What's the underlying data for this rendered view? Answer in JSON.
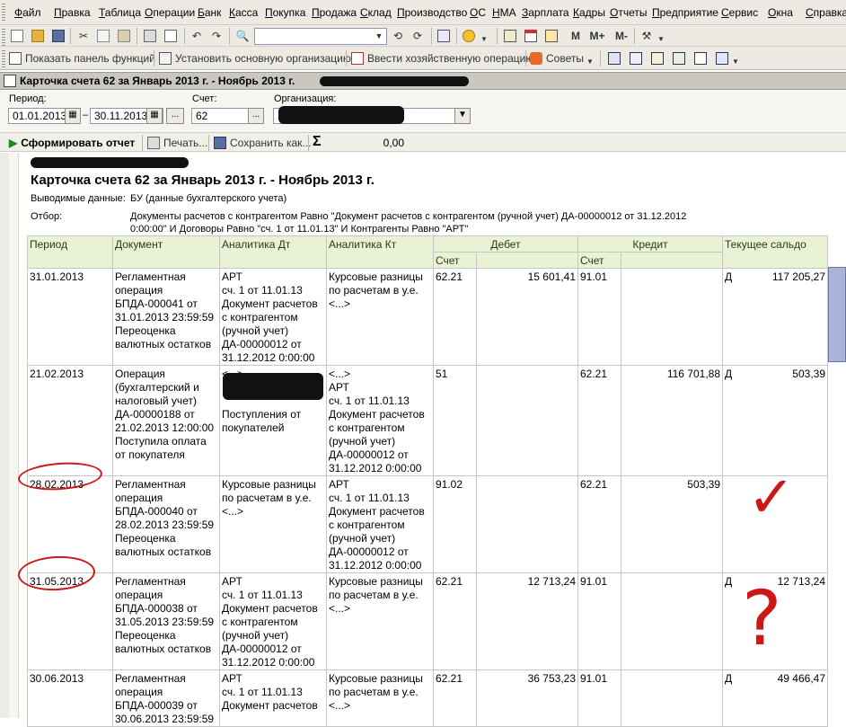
{
  "menu": [
    "Файл",
    "Правка",
    "Таблица",
    "Операции",
    "Банк",
    "Касса",
    "Покупка",
    "Продажа",
    "Склад",
    "Производство",
    "ОС",
    "НМА",
    "Зарплата",
    "Кадры",
    "Отчеты",
    "Предприятие",
    "Сервис",
    "Окна",
    "Справка"
  ],
  "toolbar2": {
    "show_panel": "Показать панель функций",
    "set_org": "Установить основную организацию",
    "enter_op": "Ввести хозяйственную операцию",
    "tips": "Советы"
  },
  "toolbar1": {
    "m1": "M",
    "m2": "M+",
    "m3": "M-"
  },
  "window": {
    "title": "Карточка счета 62 за Январь 2013 г. - Ноябрь 2013 г."
  },
  "form": {
    "period_label": "Период:",
    "date_from": "01.01.2013",
    "date_to": "30.11.2013",
    "account_label": "Счет:",
    "account": "62",
    "org_label": "Организация:",
    "ellipsis": "...",
    "dash": "–"
  },
  "actions": {
    "generate": "Сформировать отчет",
    "print": "Печать...",
    "save": "Сохранить как...",
    "sum_symbol": "Σ",
    "sum": "0,00"
  },
  "report": {
    "title": "Карточка счета 62 за Январь 2013 г. - Ноябрь 2013 г.",
    "output_label": "Выводимые данные:",
    "output_value": "БУ (данные бухгалтерского учета)",
    "filter_label": "Отбор:",
    "filter_line1": "Документы расчетов с контрагентом Равно \"Документ расчетов с контрагентом (ручной учет) ДА-00000012 от 31.12.2012",
    "filter_line2": "0:00:00\" И Договоры Равно \"сч. 1 от 11.01.13\" И Контрагенты Равно \"АРТ\"",
    "headers": {
      "period": "Период",
      "document": "Документ",
      "an_dt": "Аналитика Дт",
      "an_kt": "Аналитика Кт",
      "debit": "Дебет",
      "credit": "Кредит",
      "balance": "Текущее сальдо",
      "account": "Счет"
    },
    "rows": [
      {
        "period": "31.01.2013",
        "doc": [
          "Регламентная",
          "операция",
          "БПДА-000041 от",
          "31.01.2013 23:59:59",
          "Переоценка",
          "валютных остатков"
        ],
        "dt": [
          "АРТ",
          "сч. 1 от 11.01.13",
          "Документ расчетов",
          "с контрагентом",
          "(ручной учет)",
          "ДА-00000012 от",
          "31.12.2012 0:00:00"
        ],
        "kt": [
          "Курсовые разницы",
          "по расчетам в у.е.",
          "<...>"
        ],
        "d_acc": "62.21",
        "d_sum": "15 601,41",
        "c_acc": "91.01",
        "c_sum": "",
        "b_side": "Д",
        "b_sum": "117 205,27"
      },
      {
        "period": "21.02.2013",
        "doc": [
          "Операция",
          "(бухгалтерский и",
          "налоговый учет)",
          "ДА-00000188 от",
          "21.02.2013 12:00:00",
          "Поступила оплата",
          "от покупателя"
        ],
        "dt": [
          "<...>",
          "",
          "",
          "Поступления от",
          "покупателей"
        ],
        "kt": [
          "<...>",
          "АРТ",
          "сч. 1 от 11.01.13",
          "Документ расчетов",
          "с контрагентом",
          "(ручной учет)",
          "ДА-00000012 от",
          "31.12.2012 0:00:00"
        ],
        "d_acc": "51",
        "d_sum": "",
        "c_acc": "62.21",
        "c_sum": "116 701,88",
        "b_side": "Д",
        "b_sum": "503,39"
      },
      {
        "period": "28.02.2013",
        "doc": [
          "Регламентная",
          "операция",
          "БПДА-000040 от",
          "28.02.2013 23:59:59",
          "Переоценка",
          "валютных остатков"
        ],
        "dt": [
          "Курсовые разницы",
          "по расчетам в у.е.",
          "<...>"
        ],
        "kt": [
          "АРТ",
          "сч. 1 от 11.01.13",
          "Документ расчетов",
          "с контрагентом",
          "(ручной учет)",
          "ДА-00000012 от",
          "31.12.2012 0:00:00"
        ],
        "d_acc": "91.02",
        "d_sum": "",
        "c_acc": "62.21",
        "c_sum": "503,39",
        "b_side": "",
        "b_sum": ""
      },
      {
        "period": "31.05.2013",
        "doc": [
          "Регламентная",
          "операция",
          "БПДА-000038 от",
          "31.05.2013 23:59:59",
          "Переоценка",
          "валютных остатков"
        ],
        "dt": [
          "АРТ",
          "сч. 1 от 11.01.13",
          "Документ расчетов",
          "с контрагентом",
          "(ручной учет)",
          "ДА-00000012 от",
          "31.12.2012 0:00:00"
        ],
        "kt": [
          "Курсовые разницы",
          "по расчетам в у.е.",
          "<...>"
        ],
        "d_acc": "62.21",
        "d_sum": "12 713,24",
        "c_acc": "91.01",
        "c_sum": "",
        "b_side": "Д",
        "b_sum": "12 713,24"
      },
      {
        "period": "30.06.2013",
        "doc": [
          "Регламентная",
          "операция",
          "БПДА-000039 от",
          "30.06.2013 23:59:59"
        ],
        "dt": [
          "АРТ",
          "сч. 1 от 11.01.13",
          "Документ расчетов"
        ],
        "kt": [
          "Курсовые разницы",
          "по расчетам в у.е.",
          "<...>"
        ],
        "d_acc": "62.21",
        "d_sum": "36 753,23",
        "c_acc": "91.01",
        "c_sum": "",
        "b_side": "Д",
        "b_sum": "49 466,47"
      }
    ]
  },
  "annotations": {
    "check": "✓",
    "question": "?"
  }
}
